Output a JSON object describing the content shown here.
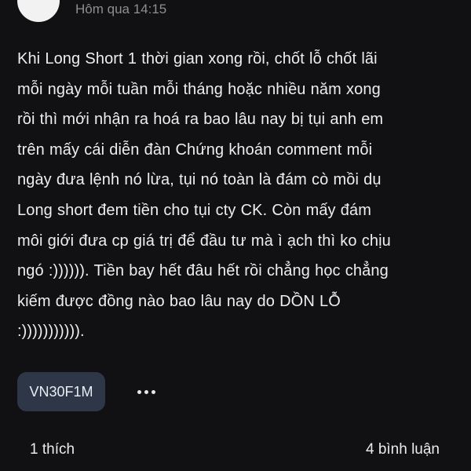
{
  "post": {
    "timestamp": "Hôm qua 14:15",
    "body_lines": [
      "Khi Long Short 1 thời gian xong rồi, chốt lỗ chốt lãi",
      "mỗi ngày mỗi tuần mỗi tháng hoặc nhiều năm xong",
      "rồi thì mới nhận ra hoá ra bao lâu nay bị tụi anh em",
      "trên mấy cái diễn đàn Chứng khoán comment mỗi",
      "ngày đưa lệnh nó lừa, tụi nó toàn là đám cò mồi dụ",
      "Long short đem tiền cho tụi cty CK. Còn mấy đám",
      "môi giới đưa cp giá trị để đầu tư mà ì ạch thì ko chịu",
      "ngó :)))))). Tiền bay hết đâu hết rồi chẳng học chẳng",
      "kiếm được đồng nào bao lâu nay do DỒN LỖ",
      ":)))))))))))."
    ],
    "tag": "VN30F1M",
    "more_icon": "more-horizontal-icon",
    "likes_label": "1 thích",
    "comments_label": "4 bình luận"
  }
}
